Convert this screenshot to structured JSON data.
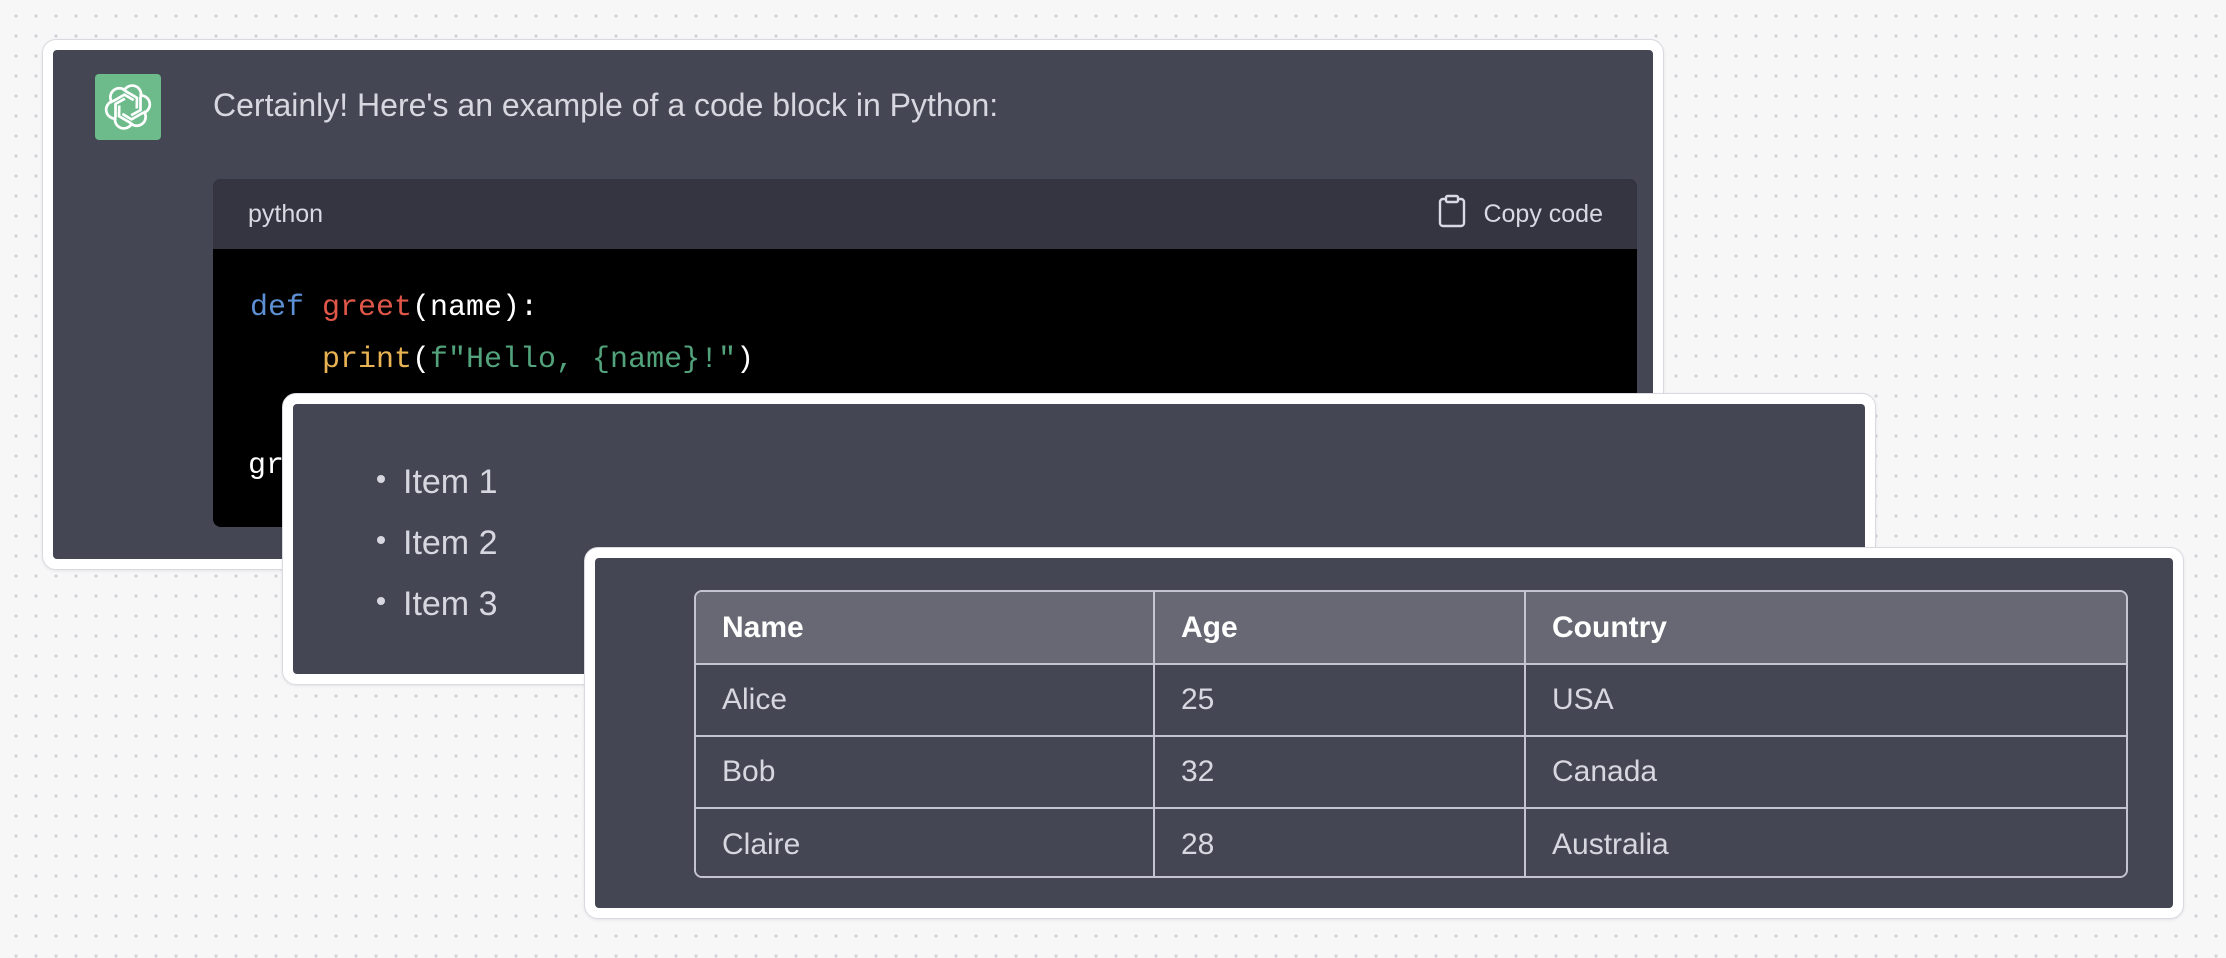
{
  "chat": {
    "message": "Certainly! Here's an example of a code block in Python:",
    "code_block": {
      "language": "python",
      "copy_label": "Copy code",
      "lines": [
        {
          "kw": "def",
          "fn": "greet",
          "rest": "(name):"
        },
        {
          "bi": "print",
          "open": "(",
          "str": "f\"Hello, {name}!\"",
          "close": ")"
        },
        {
          "partial": "gr"
        }
      ]
    }
  },
  "list": {
    "items": [
      "Item 1",
      "Item 2",
      "Item 3"
    ]
  },
  "table": {
    "headers": [
      "Name",
      "Age",
      "Country"
    ],
    "rows": [
      [
        "Alice",
        "25",
        "USA"
      ],
      [
        "Bob",
        "32",
        "Canada"
      ],
      [
        "Claire",
        "28",
        "Australia"
      ]
    ]
  },
  "colors": {
    "avatar_bg": "#6dba8a",
    "panel_bg": "#444654",
    "code_bg": "#000000",
    "code_header_bg": "#343541",
    "keyword": "#5d8fd4",
    "function": "#e0574a",
    "builtin": "#e9b252",
    "string": "#52a37c"
  },
  "icons": {
    "avatar": "openai-logo-icon",
    "copy": "clipboard-icon"
  }
}
